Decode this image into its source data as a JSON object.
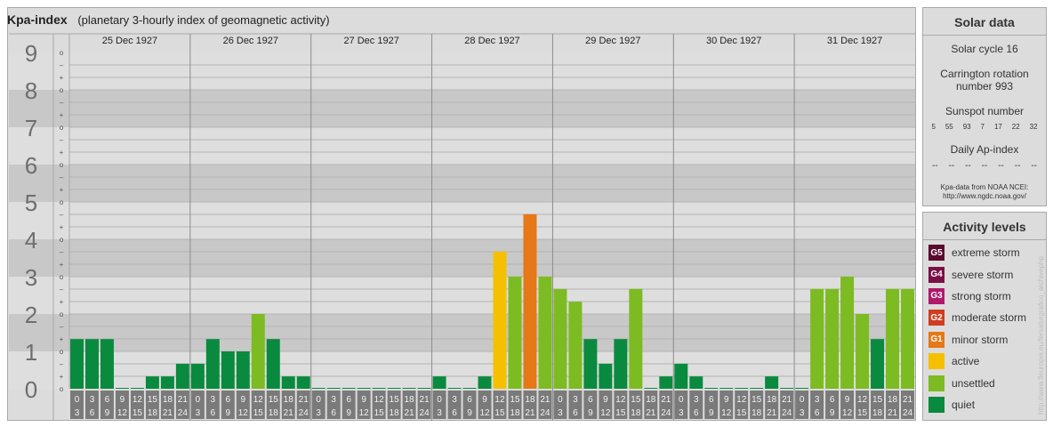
{
  "header": {
    "title": "Kpa-index",
    "subtitle": "(planetary 3-hourly index of geomagnetic activity)"
  },
  "chart_data": {
    "type": "bar",
    "title": "Kpa-index",
    "subtitle": "(planetary 3-hourly index of geomagnetic activity)",
    "ylim": [
      0,
      9
    ],
    "y_ticks": [
      "0",
      "1",
      "2",
      "3",
      "4",
      "5",
      "6",
      "7",
      "8",
      "9"
    ],
    "y_subticks": [
      "o",
      "+",
      "–"
    ],
    "days": [
      "25 Dec 1927",
      "26 Dec 1927",
      "27 Dec 1927",
      "28 Dec 1927",
      "29 Dec 1927",
      "30 Dec 1927",
      "31 Dec 1927"
    ],
    "interval_start": [
      "0",
      "3",
      "6",
      "9",
      "12",
      "15",
      "18",
      "21"
    ],
    "interval_end": [
      "3",
      "6",
      "9",
      "12",
      "15",
      "18",
      "21",
      "24"
    ],
    "values": [
      1.33,
      1.33,
      1.33,
      0,
      0,
      0.33,
      0.33,
      0.67,
      0.67,
      1.33,
      1.0,
      1.0,
      2.0,
      1.33,
      0.33,
      0.33,
      0,
      0,
      0,
      0,
      0,
      0,
      0,
      0,
      0.33,
      0,
      0,
      0.33,
      3.67,
      3.0,
      4.67,
      3.0,
      2.67,
      2.33,
      1.33,
      0.67,
      1.33,
      2.67,
      0,
      0.33,
      0.67,
      0.33,
      0,
      0,
      0,
      0,
      0.33,
      0,
      0,
      2.67,
      2.67,
      3.0,
      2.0,
      1.33,
      2.67,
      2.67
    ],
    "colors": {
      "quiet": "#0a8a3e",
      "unsettled": "#7dbb22",
      "active": "#f5c000",
      "minor_storm": "#e67817"
    },
    "grid": true
  },
  "solar": {
    "heading": "Solar data",
    "cycle": "Solar cycle 16",
    "carrington_line1": "Carrington rotation",
    "carrington_line2": "number 993",
    "sunspot_heading": "Sunspot number",
    "sunspot_values": [
      "5",
      "55",
      "93",
      "7",
      "17",
      "22",
      "32"
    ],
    "ap_heading": "Daily Ap-index",
    "ap_values": [
      "--",
      "--",
      "--",
      "--",
      "--",
      "--",
      "--"
    ],
    "credit_line1": "Kpa-data from NOAA NCEI:",
    "credit_line2": "http://www.ngdc.noaa.gov/"
  },
  "activity": {
    "heading": "Activity levels",
    "levels": [
      {
        "badge": "G5",
        "label": "extreme storm",
        "color": "#5a0a2e"
      },
      {
        "badge": "G4",
        "label": "severe storm",
        "color": "#7a0f47"
      },
      {
        "badge": "G3",
        "label": "strong storm",
        "color": "#b0186b"
      },
      {
        "badge": "G2",
        "label": "moderate storm",
        "color": "#cf3d1f"
      },
      {
        "badge": "G1",
        "label": "minor storm",
        "color": "#e67817"
      },
      {
        "badge": "",
        "label": "active",
        "color": "#f5c000"
      },
      {
        "badge": "",
        "label": "unsettled",
        "color": "#7dbb22"
      },
      {
        "badge": "",
        "label": "quiet",
        "color": "#0a8a3e"
      }
    ]
  },
  "watermark": "http://www.fleuropei.eu/fersaturgrafico_archivephp"
}
